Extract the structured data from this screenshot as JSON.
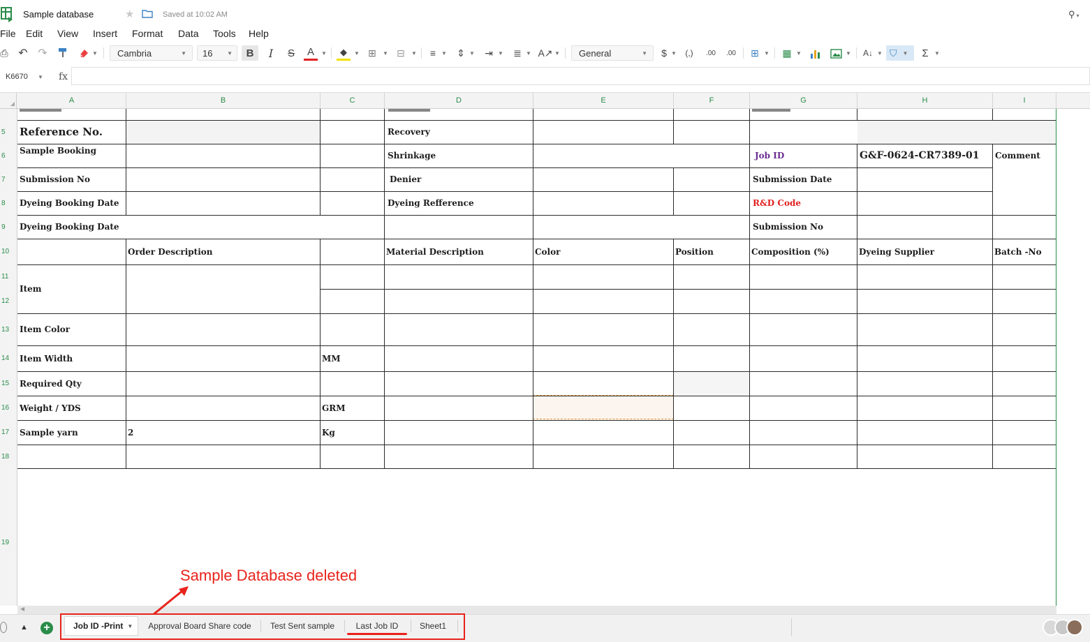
{
  "app": {
    "title": "Sample database",
    "saved_status": "Saved at 10:02 AM"
  },
  "menu": [
    "File",
    "Edit",
    "View",
    "Insert",
    "Format",
    "Data",
    "Tools",
    "Help"
  ],
  "toolbar": {
    "font_family": "Cambria",
    "font_size": "16",
    "number_format": "General",
    "currency": "$",
    "paren": "(,)",
    "dec_decrease": ".00",
    "dec_increase": ".00"
  },
  "formula_bar": {
    "cell_ref": "K6670",
    "fx": "fx",
    "value": ""
  },
  "columns": [
    "A",
    "B",
    "C",
    "D",
    "E",
    "F",
    "G",
    "H",
    "I"
  ],
  "rows": [
    "5",
    "6",
    "7",
    "8",
    "9",
    "10",
    "11",
    "12",
    "13",
    "14",
    "15",
    "16",
    "17",
    "18",
    "19"
  ],
  "cells": {
    "a5": "Reference No.",
    "d5": "Recovery",
    "a6": "Sample Booking",
    "d6": "Shrinkage",
    "g6": "Job ID",
    "h6": "G&F-0624-CR7389-01",
    "i6": "Comment",
    "a7": "Submission No",
    "d7": "Denier",
    "g7": "Submission Date",
    "a8": "Dyeing Booking Date",
    "d8": "Dyeing Refference",
    "g8": "R&D Code",
    "a9": "Dyeing Booking Date",
    "g9": "Submission No",
    "b10": "Order Description",
    "d10": "Material Description",
    "e10": "Color",
    "f10": "Position",
    "g10": "Composition (%)",
    "h10": "Dyeing Supplier",
    "i10": "Batch -No",
    "a11": "Item",
    "a13": "Item Color",
    "a14": "Item Width",
    "c14": "MM",
    "a15": "Required Qty",
    "a16": "Weight / YDS",
    "c16": "GRM",
    "a17": "Sample yarn",
    "b17": "2",
    "c17": "Kg"
  },
  "tabs": [
    "Job ID -Print",
    "Approval Board Share code",
    "Test Sent sample",
    "Last Job ID",
    "Sheet1"
  ],
  "annotation": "Sample Database deleted",
  "colors": {
    "accent_green": "#2a8c4a",
    "job_id_purple": "#6a2c91",
    "rd_code_red": "#e02020",
    "annotation_red": "#e8231c"
  }
}
